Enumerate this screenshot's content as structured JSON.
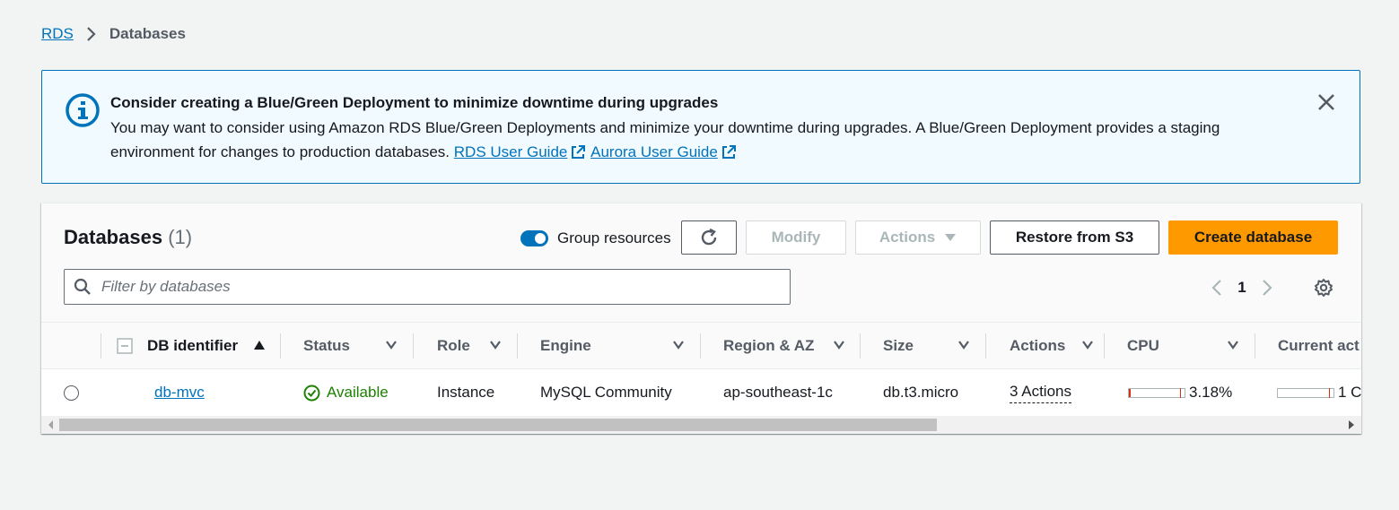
{
  "breadcrumb": {
    "root": "RDS",
    "current": "Databases"
  },
  "banner": {
    "title": "Consider creating a Blue/Green Deployment to minimize downtime during upgrades",
    "body": "You may want to consider using Amazon RDS Blue/Green Deployments and minimize your downtime during upgrades. A Blue/Green Deployment provides a staging environment for changes to production databases.",
    "link1": "RDS User Guide",
    "link2": "Aurora User Guide",
    "icon": "info-icon",
    "accent": "#0073bb",
    "background": "#f1faff"
  },
  "panel": {
    "title": "Databases",
    "count": "(1)",
    "toggle_label": "Group resources",
    "toggle_on": true,
    "buttons": {
      "modify": "Modify",
      "actions": "Actions",
      "restore": "Restore from S3",
      "create": "Create database"
    },
    "filter_placeholder": "Filter by databases",
    "page": "1"
  },
  "table": {
    "columns": [
      "DB identifier",
      "Status",
      "Role",
      "Engine",
      "Region & AZ",
      "Size",
      "Actions",
      "CPU",
      "Current act"
    ],
    "rows": [
      {
        "db_identifier": "db-mvc",
        "status": "Available",
        "role": "Instance",
        "engine": "MySQL Community",
        "region_az": "ap-southeast-1c",
        "size": "db.t3.micro",
        "actions": "3 Actions",
        "cpu": "3.18%",
        "cpu_fraction": 0.0318,
        "current_activity": "1 C"
      }
    ]
  },
  "colors": {
    "primary_button": "#ff9900",
    "link": "#0073bb",
    "status_ok": "#1d8102"
  }
}
